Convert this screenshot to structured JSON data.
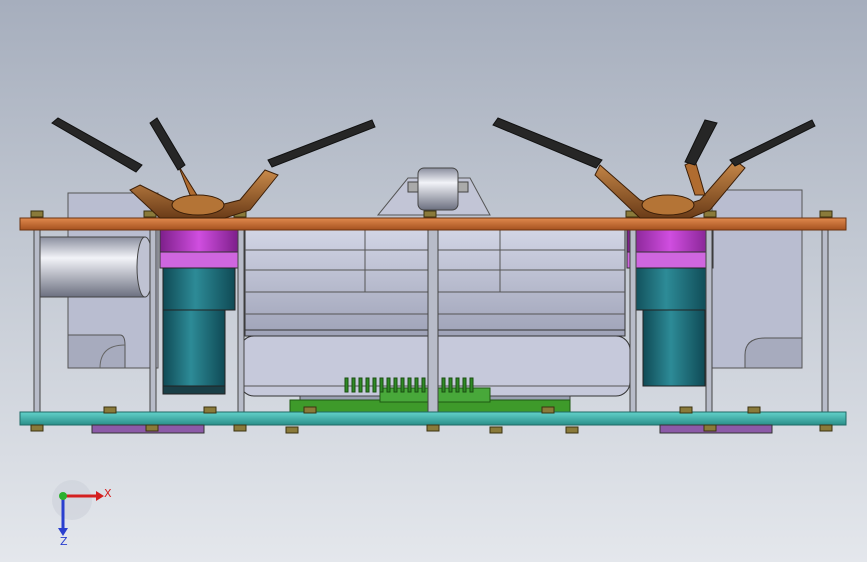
{
  "viewport": {
    "background_top": "#a6aebd",
    "background_bottom": "#e4e7ec"
  },
  "colors": {
    "top_plate": "#c8692e",
    "bottom_plate": "#3fb7b0",
    "housing": "#bfc3d8",
    "motor_magenta": "#b32fc2",
    "motor_teal": "#1f6f7c",
    "bracket_bronze": "#9a5a28",
    "arm_dark": "#262626",
    "pcb_green": "#3e9a2a"
  },
  "triad": {
    "x_label": "X",
    "z_label": "Z",
    "x_color": "#d42020",
    "y_color": "#2db02d",
    "z_color": "#2a3fcf",
    "icons": [
      "axis-triad-icon"
    ]
  }
}
